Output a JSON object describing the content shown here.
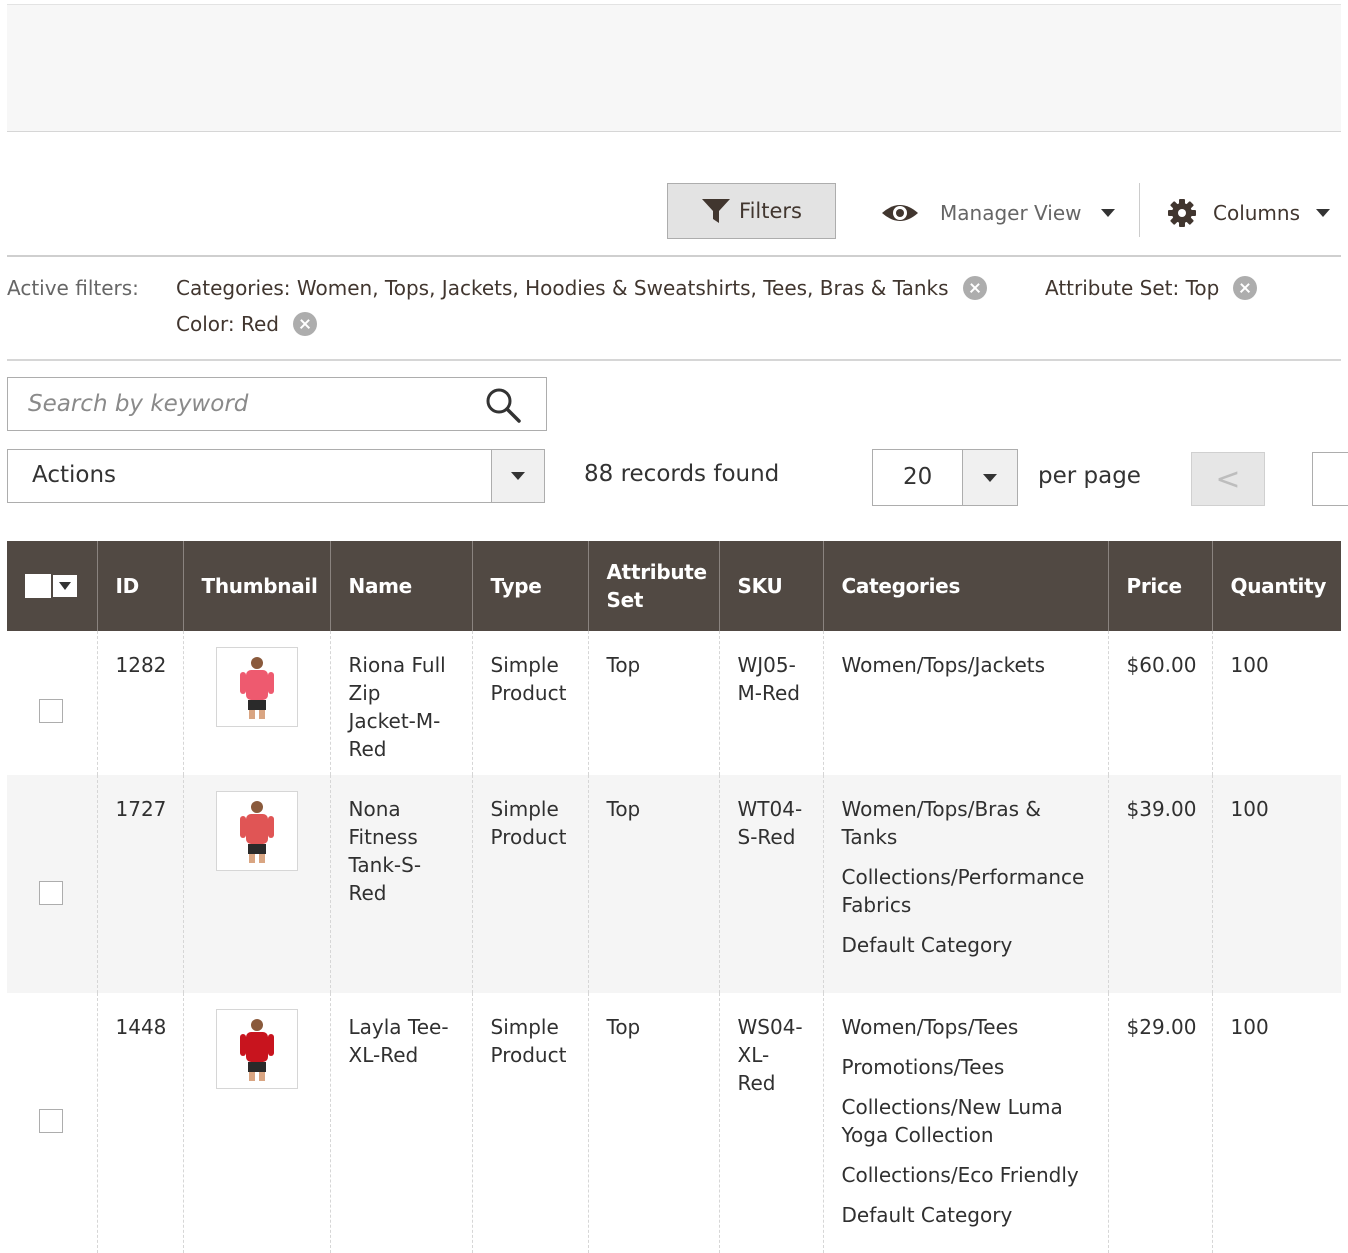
{
  "toolbar": {
    "filters_label": "Filters",
    "view_label": "Manager View",
    "columns_label": "Columns"
  },
  "active_filters": {
    "title": "Active filters:",
    "items": [
      {
        "label": "Categories: Women, Tops, Jackets, Hoodies & Sweatshirts, Tees, Bras & Tanks"
      },
      {
        "label": "Attribute Set: Top"
      },
      {
        "label": "Color: Red"
      }
    ]
  },
  "search": {
    "placeholder": "Search by keyword",
    "value": ""
  },
  "actions": {
    "label": "Actions"
  },
  "records_found": "88 records found",
  "pager": {
    "per_page_value": "20",
    "per_page_label": "per page",
    "prev_label": "<"
  },
  "grid": {
    "columns": [
      "ID",
      "Thumbnail",
      "Name",
      "Type",
      "Attribute Set",
      "SKU",
      "Categories",
      "Price",
      "Quantity"
    ],
    "rows": [
      {
        "id": "1282",
        "thumbnail_color": "#ee5a6f",
        "name": "Riona Full Zip Jacket-M-Red",
        "type": "Simple Product",
        "attribute_set": "Top",
        "sku": "WJ05-M-Red",
        "categories": [
          "Women/Tops/Jackets"
        ],
        "price": "$60.00",
        "quantity": "100"
      },
      {
        "id": "1727",
        "thumbnail_color": "#e05555",
        "name": "Nona Fitness Tank-S-Red",
        "type": "Simple Product",
        "attribute_set": "Top",
        "sku": "WT04-S-Red",
        "categories": [
          "Women/Tops/Bras & Tanks",
          "Collections/Performance Fabrics",
          "Default Category"
        ],
        "price": "$39.00",
        "quantity": "100"
      },
      {
        "id": "1448",
        "thumbnail_color": "#c8141e",
        "name": "Layla Tee-XL-Red",
        "type": "Simple Product",
        "attribute_set": "Top",
        "sku": "WS04-XL-Red",
        "categories": [
          "Women/Tops/Tees",
          "Promotions/Tees",
          "Collections/New Luma Yoga Collection",
          "Collections/Eco Friendly",
          "Default Category"
        ],
        "price": "$29.00",
        "quantity": "100"
      }
    ]
  },
  "colors": {
    "header_bg": "#514943",
    "accent": "#41362f"
  }
}
